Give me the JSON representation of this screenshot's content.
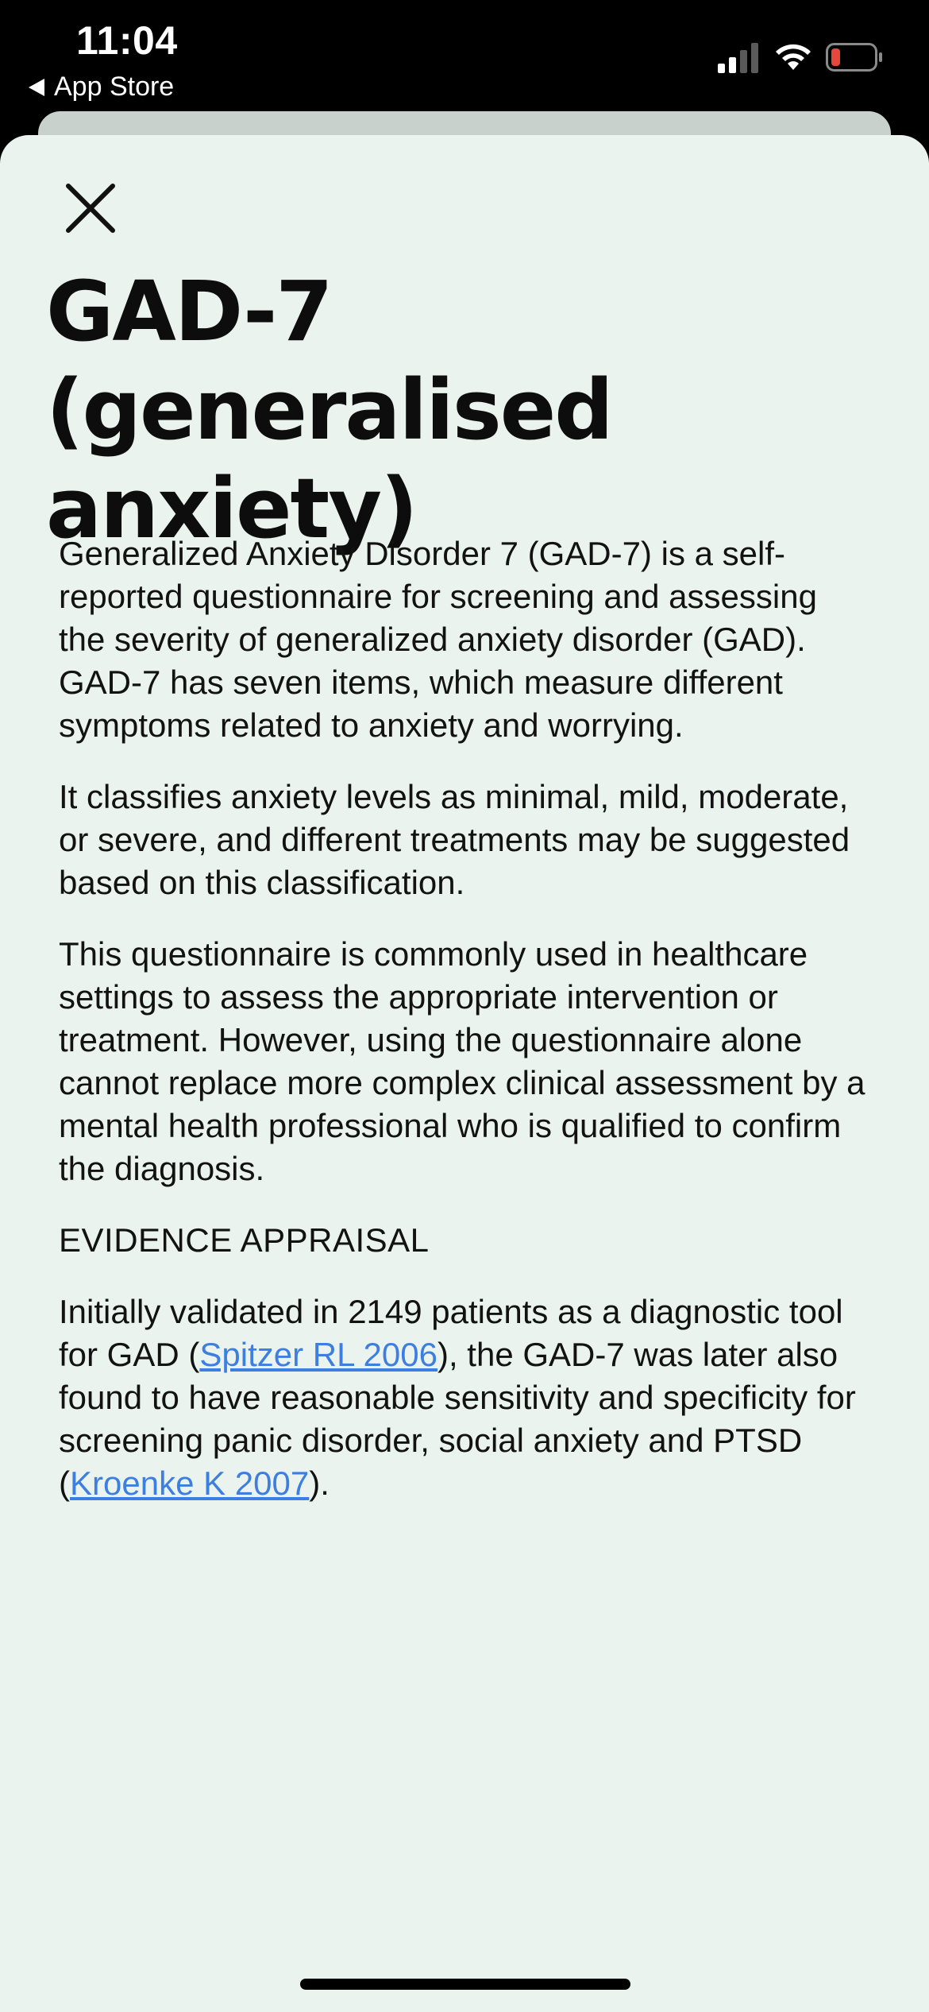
{
  "status_bar": {
    "time": "11:04",
    "back_label": "App Store",
    "icons": [
      "signal-icon",
      "wifi-icon",
      "battery-icon"
    ],
    "battery_color": "#e5473d"
  },
  "sheet": {
    "close_icon": "close-icon",
    "title": "GAD-7 (generalised anxiety)",
    "background_color": "#ebf3ee",
    "paragraphs": [
      "Generalized Anxiety Disorder 7 (GAD-7) is a self-reported questionnaire for screening and assessing the severity of generalized anxiety disorder (GAD). GAD-7 has seven items, which measure different symptoms related to anxiety and worrying.",
      "It classifies anxiety levels as minimal, mild, moderate, or severe, and different treatments may be suggested based on this classification.",
      "This questionnaire is commonly used in healthcare settings to assess the appropriate intervention or treatment. However, using the questionnaire alone cannot replace more complex clinical assessment by a mental health professional who is qualified to confirm the diagnosis."
    ],
    "evidence": {
      "heading": "EVIDENCE APPRAISAL",
      "text_1": "Initially validated in 2149 patients as a diagnostic tool for GAD (",
      "link_1": "Spitzer RL 2006",
      "text_2": "), the GAD-7 was later also found to have reasonable sensitivity and specificity for screening panic disorder, social anxiety and PTSD (",
      "link_2": "Kroenke K 2007",
      "text_3": ").",
      "link_color": "#3d7fe0"
    }
  }
}
